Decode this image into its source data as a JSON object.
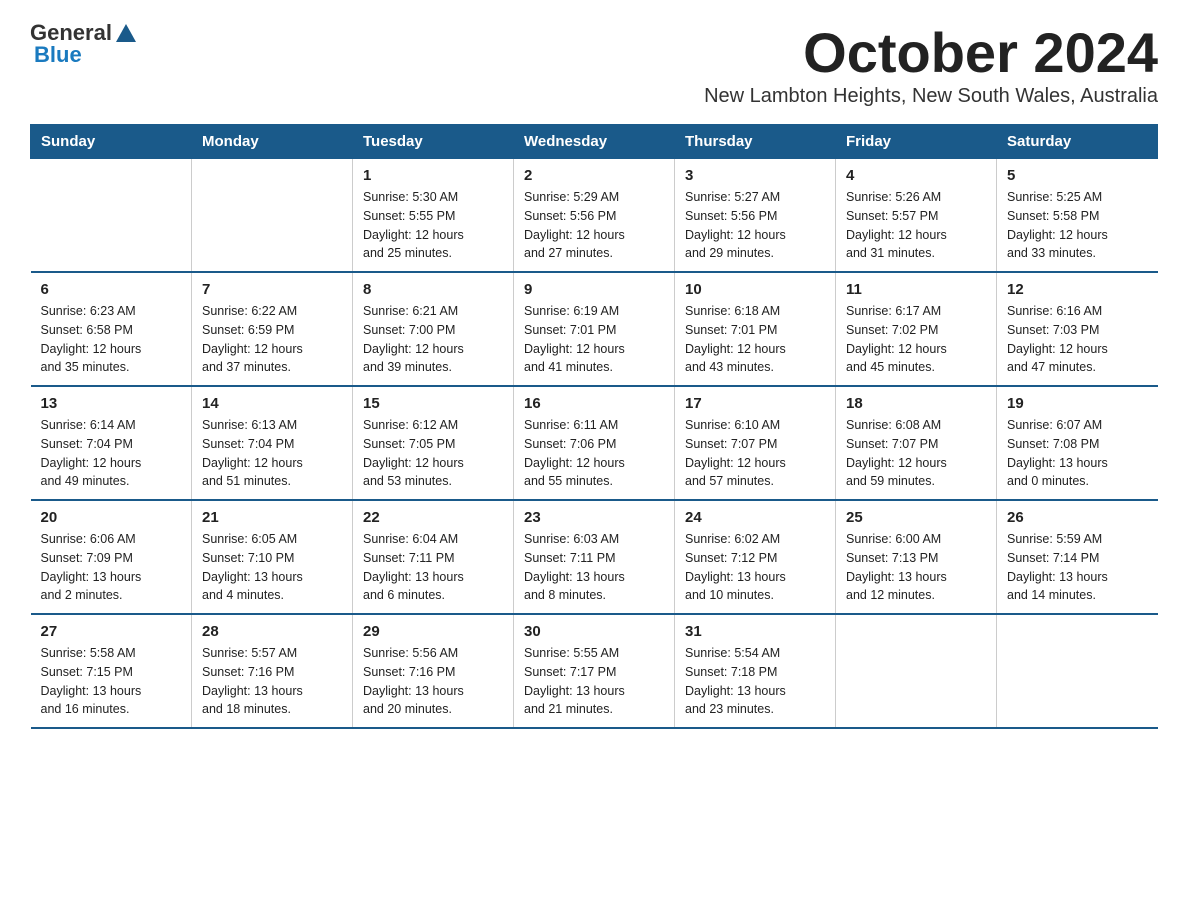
{
  "logo": {
    "general": "General",
    "blue": "Blue"
  },
  "title": "October 2024",
  "location": "New Lambton Heights, New South Wales, Australia",
  "days_of_week": [
    "Sunday",
    "Monday",
    "Tuesday",
    "Wednesday",
    "Thursday",
    "Friday",
    "Saturday"
  ],
  "weeks": [
    [
      {
        "day": "",
        "info": ""
      },
      {
        "day": "",
        "info": ""
      },
      {
        "day": "1",
        "info": "Sunrise: 5:30 AM\nSunset: 5:55 PM\nDaylight: 12 hours\nand 25 minutes."
      },
      {
        "day": "2",
        "info": "Sunrise: 5:29 AM\nSunset: 5:56 PM\nDaylight: 12 hours\nand 27 minutes."
      },
      {
        "day": "3",
        "info": "Sunrise: 5:27 AM\nSunset: 5:56 PM\nDaylight: 12 hours\nand 29 minutes."
      },
      {
        "day": "4",
        "info": "Sunrise: 5:26 AM\nSunset: 5:57 PM\nDaylight: 12 hours\nand 31 minutes."
      },
      {
        "day": "5",
        "info": "Sunrise: 5:25 AM\nSunset: 5:58 PM\nDaylight: 12 hours\nand 33 minutes."
      }
    ],
    [
      {
        "day": "6",
        "info": "Sunrise: 6:23 AM\nSunset: 6:58 PM\nDaylight: 12 hours\nand 35 minutes."
      },
      {
        "day": "7",
        "info": "Sunrise: 6:22 AM\nSunset: 6:59 PM\nDaylight: 12 hours\nand 37 minutes."
      },
      {
        "day": "8",
        "info": "Sunrise: 6:21 AM\nSunset: 7:00 PM\nDaylight: 12 hours\nand 39 minutes."
      },
      {
        "day": "9",
        "info": "Sunrise: 6:19 AM\nSunset: 7:01 PM\nDaylight: 12 hours\nand 41 minutes."
      },
      {
        "day": "10",
        "info": "Sunrise: 6:18 AM\nSunset: 7:01 PM\nDaylight: 12 hours\nand 43 minutes."
      },
      {
        "day": "11",
        "info": "Sunrise: 6:17 AM\nSunset: 7:02 PM\nDaylight: 12 hours\nand 45 minutes."
      },
      {
        "day": "12",
        "info": "Sunrise: 6:16 AM\nSunset: 7:03 PM\nDaylight: 12 hours\nand 47 minutes."
      }
    ],
    [
      {
        "day": "13",
        "info": "Sunrise: 6:14 AM\nSunset: 7:04 PM\nDaylight: 12 hours\nand 49 minutes."
      },
      {
        "day": "14",
        "info": "Sunrise: 6:13 AM\nSunset: 7:04 PM\nDaylight: 12 hours\nand 51 minutes."
      },
      {
        "day": "15",
        "info": "Sunrise: 6:12 AM\nSunset: 7:05 PM\nDaylight: 12 hours\nand 53 minutes."
      },
      {
        "day": "16",
        "info": "Sunrise: 6:11 AM\nSunset: 7:06 PM\nDaylight: 12 hours\nand 55 minutes."
      },
      {
        "day": "17",
        "info": "Sunrise: 6:10 AM\nSunset: 7:07 PM\nDaylight: 12 hours\nand 57 minutes."
      },
      {
        "day": "18",
        "info": "Sunrise: 6:08 AM\nSunset: 7:07 PM\nDaylight: 12 hours\nand 59 minutes."
      },
      {
        "day": "19",
        "info": "Sunrise: 6:07 AM\nSunset: 7:08 PM\nDaylight: 13 hours\nand 0 minutes."
      }
    ],
    [
      {
        "day": "20",
        "info": "Sunrise: 6:06 AM\nSunset: 7:09 PM\nDaylight: 13 hours\nand 2 minutes."
      },
      {
        "day": "21",
        "info": "Sunrise: 6:05 AM\nSunset: 7:10 PM\nDaylight: 13 hours\nand 4 minutes."
      },
      {
        "day": "22",
        "info": "Sunrise: 6:04 AM\nSunset: 7:11 PM\nDaylight: 13 hours\nand 6 minutes."
      },
      {
        "day": "23",
        "info": "Sunrise: 6:03 AM\nSunset: 7:11 PM\nDaylight: 13 hours\nand 8 minutes."
      },
      {
        "day": "24",
        "info": "Sunrise: 6:02 AM\nSunset: 7:12 PM\nDaylight: 13 hours\nand 10 minutes."
      },
      {
        "day": "25",
        "info": "Sunrise: 6:00 AM\nSunset: 7:13 PM\nDaylight: 13 hours\nand 12 minutes."
      },
      {
        "day": "26",
        "info": "Sunrise: 5:59 AM\nSunset: 7:14 PM\nDaylight: 13 hours\nand 14 minutes."
      }
    ],
    [
      {
        "day": "27",
        "info": "Sunrise: 5:58 AM\nSunset: 7:15 PM\nDaylight: 13 hours\nand 16 minutes."
      },
      {
        "day": "28",
        "info": "Sunrise: 5:57 AM\nSunset: 7:16 PM\nDaylight: 13 hours\nand 18 minutes."
      },
      {
        "day": "29",
        "info": "Sunrise: 5:56 AM\nSunset: 7:16 PM\nDaylight: 13 hours\nand 20 minutes."
      },
      {
        "day": "30",
        "info": "Sunrise: 5:55 AM\nSunset: 7:17 PM\nDaylight: 13 hours\nand 21 minutes."
      },
      {
        "day": "31",
        "info": "Sunrise: 5:54 AM\nSunset: 7:18 PM\nDaylight: 13 hours\nand 23 minutes."
      },
      {
        "day": "",
        "info": ""
      },
      {
        "day": "",
        "info": ""
      }
    ]
  ]
}
